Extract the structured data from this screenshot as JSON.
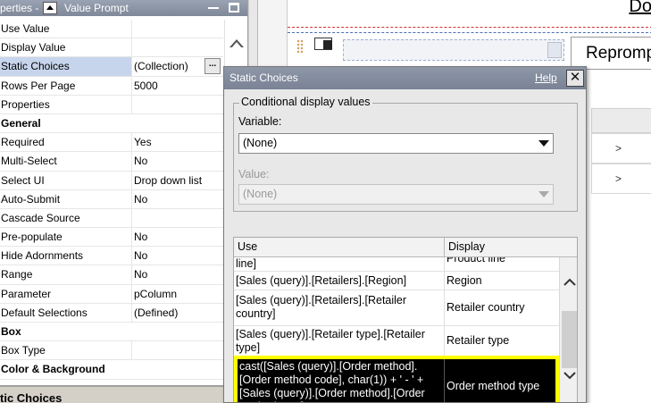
{
  "props_panel": {
    "header_title": "perties -",
    "header_subtitle": "Value Prompt",
    "rows": [
      {
        "key": "Use Value",
        "value": "",
        "group": false
      },
      {
        "key": "Display Value",
        "value": "",
        "group": false
      },
      {
        "key": "Static Choices",
        "value": "(Collection)",
        "group": false,
        "selected": true,
        "ellipsis": "..."
      },
      {
        "key": "Rows Per Page",
        "value": "5000",
        "group": false
      },
      {
        "key": "Properties",
        "value": "",
        "group": false
      },
      {
        "key": "General",
        "value": "",
        "group": true
      },
      {
        "key": "Required",
        "value": "Yes",
        "group": false
      },
      {
        "key": "Multi-Select",
        "value": "No",
        "group": false
      },
      {
        "key": "Select UI",
        "value": "Drop down list",
        "group": false
      },
      {
        "key": "Auto-Submit",
        "value": "No",
        "group": false
      },
      {
        "key": "Cascade Source",
        "value": "",
        "group": false
      },
      {
        "key": "Pre-populate",
        "value": "No",
        "group": false
      },
      {
        "key": "Hide Adornments",
        "value": "No",
        "group": false
      },
      {
        "key": "Range",
        "value": "No",
        "group": false
      },
      {
        "key": "Parameter",
        "value": "pColumn",
        "group": false
      },
      {
        "key": "Default Selections",
        "value": "(Defined)",
        "group": false
      },
      {
        "key": "Box",
        "value": "",
        "group": true
      },
      {
        "key": "Box Type",
        "value": "",
        "group": false
      },
      {
        "key": "Color & Background",
        "value": "",
        "group": true
      }
    ],
    "footer_label": "tic Choices"
  },
  "canvas": {
    "doc_title": "Do",
    "reprompt_label": "Reprompt",
    "fragments": [
      ">",
      ">"
    ]
  },
  "dialog": {
    "title": "Static Choices",
    "help": "Help",
    "close": "✕",
    "conditional": {
      "legend": "Conditional display values",
      "variable_label": "Variable:",
      "variable_value": "(None)",
      "value_label": "Value:",
      "value_value": "(None)"
    },
    "table": {
      "headers": {
        "use": "Use",
        "display": "Display"
      },
      "rows": [
        {
          "use": "line]",
          "display": "Product line"
        },
        {
          "use": "[Sales (query)].[Retailers].[Region]",
          "display": "Region"
        },
        {
          "use": "[Sales (query)].[Retailers].[Retailer country]",
          "display": "Retailer country"
        },
        {
          "use": "[Sales (query)].[Retailer type].[Retailer type]",
          "display": "Retailer type"
        },
        {
          "use": "cast([Sales (query)].[Order method].[Order method code], char(1)) + ' - ' + [Sales (query)].[Order method].[Order method type]",
          "display": "Order method type",
          "selected": true
        }
      ]
    }
  }
}
